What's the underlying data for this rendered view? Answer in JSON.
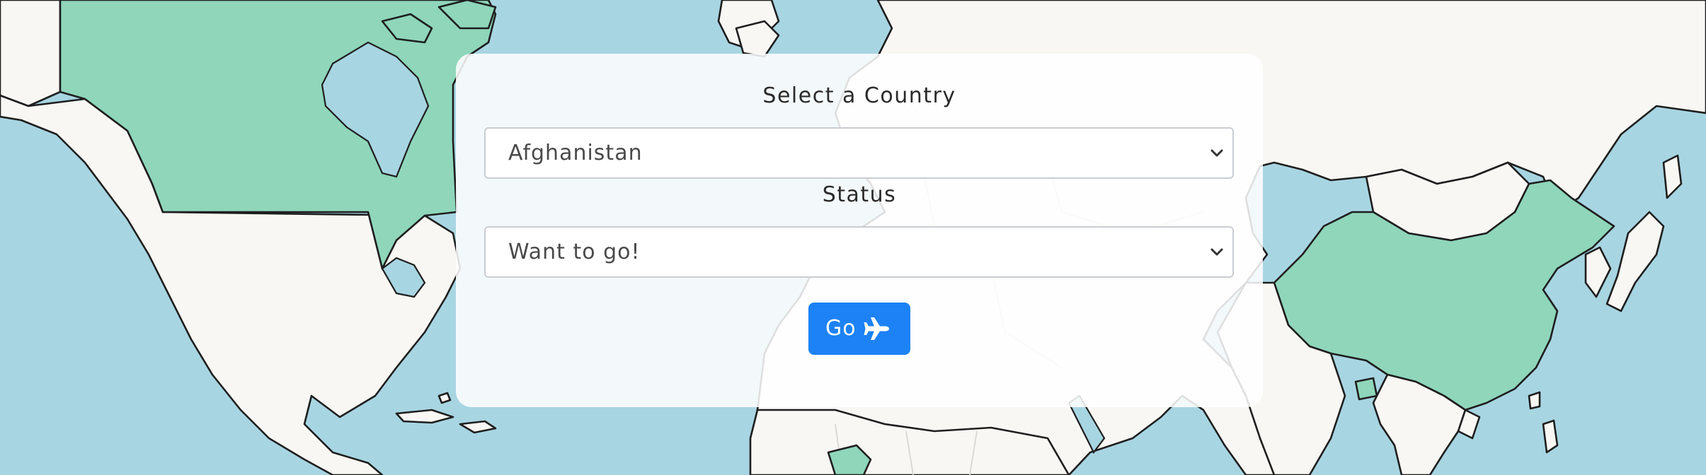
{
  "form": {
    "country_label": "Select a Country",
    "country_selected": "Afghanistan",
    "status_label": "Status",
    "status_selected": "Want to go!",
    "go_button_label": "Go",
    "go_button_icon": "plane-icon"
  },
  "colors": {
    "ocean": "#a8d5e2",
    "visited_country": "#8fd6bb",
    "button": "#1d82f5"
  }
}
